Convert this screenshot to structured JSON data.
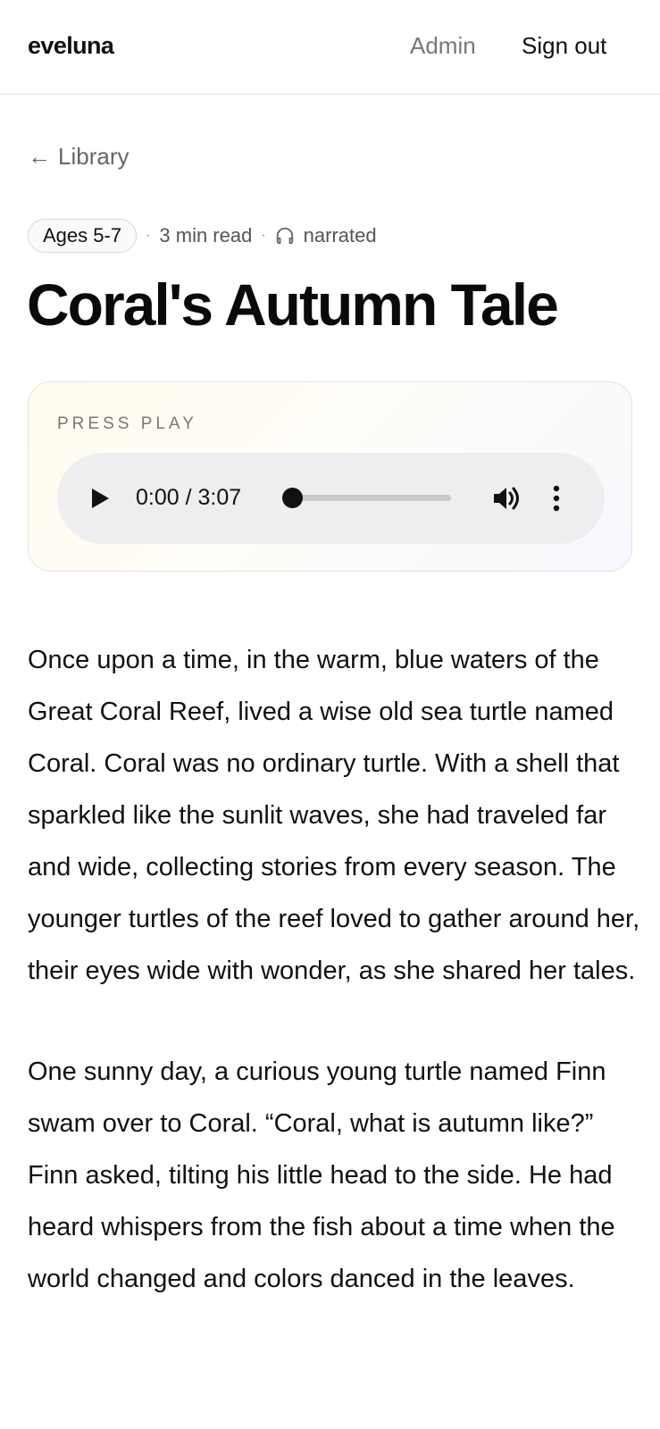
{
  "header": {
    "brand": "eveluna",
    "nav": {
      "admin": "Admin",
      "sign_out": "Sign out"
    }
  },
  "breadcrumb": {
    "arrow": "←",
    "label": "Library"
  },
  "meta": {
    "age_badge": "Ages 5-7",
    "separator": "·",
    "read_time": "3 min read",
    "narration": "narrated",
    "icon": "headphones-icon"
  },
  "story": {
    "title": "Coral's Autumn Tale",
    "paragraphs": [
      "Once upon a time, in the warm, blue waters of the Great Coral Reef, lived a wise old sea turtle named Coral. Coral was no ordinary turtle. With a shell that sparkled like the sunlit waves, she had traveled far and wide, collecting stories from every season. The younger turtles of the reef loved to gather around her, their eyes wide with wonder, as she shared her tales.",
      "One sunny day, a curious young turtle named Finn swam over to Coral. “Coral, what is autumn like?” Finn asked, tilting his little head to the side. He had heard whispers from the fish about a time when the world changed and colors danced in the leaves."
    ]
  },
  "player": {
    "label": "PRESS PLAY",
    "time_display": "0:00 / 3:07",
    "progress": 0,
    "icons": {
      "play": "play-icon",
      "volume": "volume-icon",
      "more": "more-vertical-icon"
    }
  },
  "colors": {
    "text": "#111111",
    "muted": "#777777",
    "border": "#e2e2e2",
    "card_gradient_start": "#fffbee",
    "card_gradient_end": "#f7f8fe",
    "audio_bg": "#eeeef0"
  }
}
